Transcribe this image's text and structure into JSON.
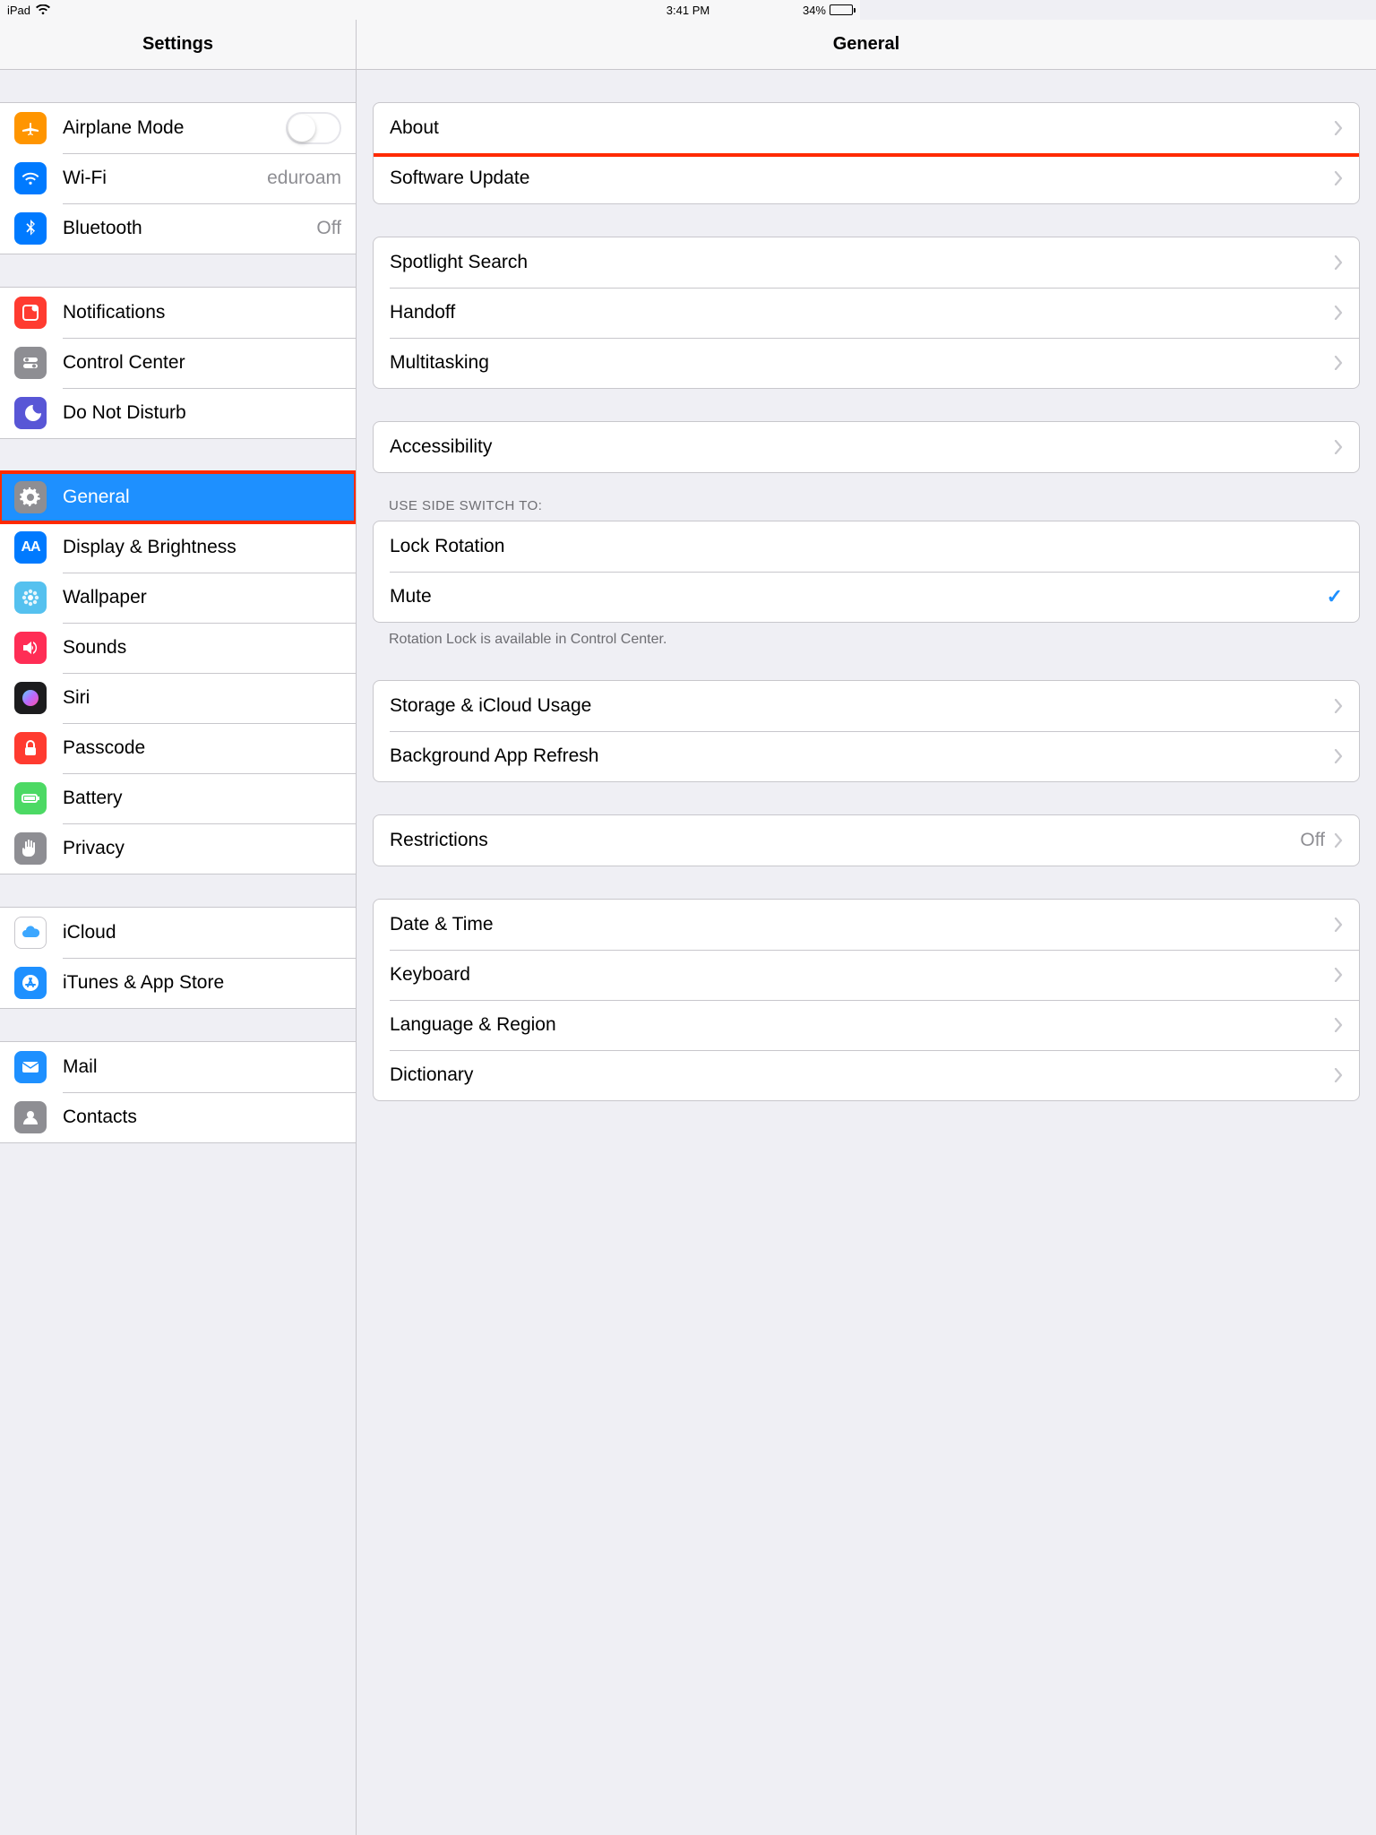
{
  "status": {
    "device": "iPad",
    "time": "3:41 PM",
    "battery_pct": "34%",
    "battery_fill_pct": 34
  },
  "sidebar": {
    "title": "Settings",
    "groups": [
      [
        {
          "id": "airplane",
          "label": "Airplane Mode",
          "icon": "airplane",
          "bg": "#ff9500",
          "control": "switch"
        },
        {
          "id": "wifi",
          "label": "Wi-Fi",
          "icon": "wifi",
          "bg": "#007aff",
          "value": "eduroam"
        },
        {
          "id": "bluetooth",
          "label": "Bluetooth",
          "icon": "bluetooth",
          "bg": "#007aff",
          "value": "Off"
        }
      ],
      [
        {
          "id": "notifications",
          "label": "Notifications",
          "icon": "notify",
          "bg": "#ff3b30"
        },
        {
          "id": "controlcenter",
          "label": "Control Center",
          "icon": "cc",
          "bg": "#8e8e93"
        },
        {
          "id": "dnd",
          "label": "Do Not Disturb",
          "icon": "moon",
          "bg": "#5856d6"
        }
      ],
      [
        {
          "id": "general",
          "label": "General",
          "icon": "gear",
          "bg": "#8e8e93",
          "selected": true,
          "highlight": true
        },
        {
          "id": "display",
          "label": "Display & Brightness",
          "icon": "aa",
          "bg": "#007aff"
        },
        {
          "id": "wallpaper",
          "label": "Wallpaper",
          "icon": "flower",
          "bg": "#55c1ef"
        },
        {
          "id": "sounds",
          "label": "Sounds",
          "icon": "speaker",
          "bg": "#ff2d55"
        },
        {
          "id": "siri",
          "label": "Siri",
          "icon": "siri",
          "bg": "#1c1c1e"
        },
        {
          "id": "passcode",
          "label": "Passcode",
          "icon": "lock",
          "bg": "#ff3b30"
        },
        {
          "id": "battery",
          "label": "Battery",
          "icon": "battery",
          "bg": "#4cd964"
        },
        {
          "id": "privacy",
          "label": "Privacy",
          "icon": "hand",
          "bg": "#8e8e93"
        }
      ],
      [
        {
          "id": "icloud",
          "label": "iCloud",
          "icon": "cloud",
          "bg": "#ffffff",
          "fg": "#3ca7ff",
          "border": true
        },
        {
          "id": "itunes",
          "label": "iTunes & App Store",
          "icon": "appstore",
          "bg": "#1e90ff"
        }
      ],
      [
        {
          "id": "mail",
          "label": "Mail",
          "icon": "mail",
          "bg": "#1e90ff"
        },
        {
          "id": "contacts",
          "label": "Contacts",
          "icon": "contacts",
          "bg": "#8e8e93"
        }
      ]
    ]
  },
  "detail": {
    "title": "General",
    "sections": [
      {
        "rows": [
          {
            "id": "about",
            "label": "About",
            "chevron": true,
            "highlight": true
          },
          {
            "id": "swupdate",
            "label": "Software Update",
            "chevron": true
          }
        ]
      },
      {
        "rows": [
          {
            "id": "spotlight",
            "label": "Spotlight Search",
            "chevron": true
          },
          {
            "id": "handoff",
            "label": "Handoff",
            "chevron": true
          },
          {
            "id": "multi",
            "label": "Multitasking",
            "chevron": true
          }
        ]
      },
      {
        "rows": [
          {
            "id": "access",
            "label": "Accessibility",
            "chevron": true
          }
        ]
      },
      {
        "header": "USE SIDE SWITCH TO:",
        "footer": "Rotation Lock is available in Control Center.",
        "rows": [
          {
            "id": "lockrot",
            "label": "Lock Rotation"
          },
          {
            "id": "mute",
            "label": "Mute",
            "checked": true
          }
        ]
      },
      {
        "rows": [
          {
            "id": "storage",
            "label": "Storage & iCloud Usage",
            "chevron": true
          },
          {
            "id": "bgapp",
            "label": "Background App Refresh",
            "chevron": true
          }
        ]
      },
      {
        "rows": [
          {
            "id": "restrict",
            "label": "Restrictions",
            "value": "Off",
            "chevron": true
          }
        ]
      },
      {
        "rows": [
          {
            "id": "datetime",
            "label": "Date & Time",
            "chevron": true
          },
          {
            "id": "keyboard",
            "label": "Keyboard",
            "chevron": true
          },
          {
            "id": "langreg",
            "label": "Language & Region",
            "chevron": true
          },
          {
            "id": "dict",
            "label": "Dictionary",
            "chevron": true
          }
        ]
      }
    ]
  }
}
